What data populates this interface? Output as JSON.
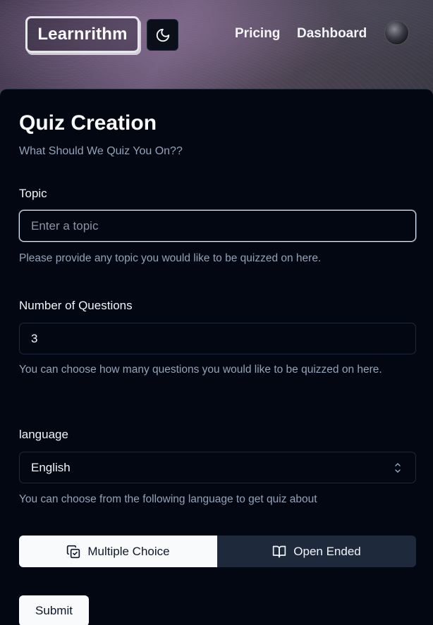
{
  "navbar": {
    "logo": "Learnrithm",
    "theme_toggle_icon": "moon-icon",
    "links": [
      "Pricing",
      "Dashboard"
    ],
    "avatar_icon": "user-avatar"
  },
  "form": {
    "title": "Quiz Creation",
    "subtitle": "What Should We Quiz You On??",
    "topic": {
      "label": "Topic",
      "placeholder": "Enter a topic",
      "value": "",
      "help": "Please provide any topic you would like to be quizzed on here."
    },
    "questions": {
      "label": "Number of Questions",
      "value": "3",
      "help": "You can choose how many questions you would like to be quizzed on here."
    },
    "language": {
      "label": "language",
      "selected": "English",
      "help": "You can choose from the following language to get quiz about"
    },
    "type_toggle": {
      "options": [
        "Multiple Choice",
        "Open Ended"
      ],
      "selected": "Multiple Choice"
    },
    "submit_label": "Submit"
  },
  "colors": {
    "background": "#030712",
    "selected_segment": "#f8fafc",
    "unselected_segment": "#1e293b",
    "muted_text": "#94a3b8"
  }
}
